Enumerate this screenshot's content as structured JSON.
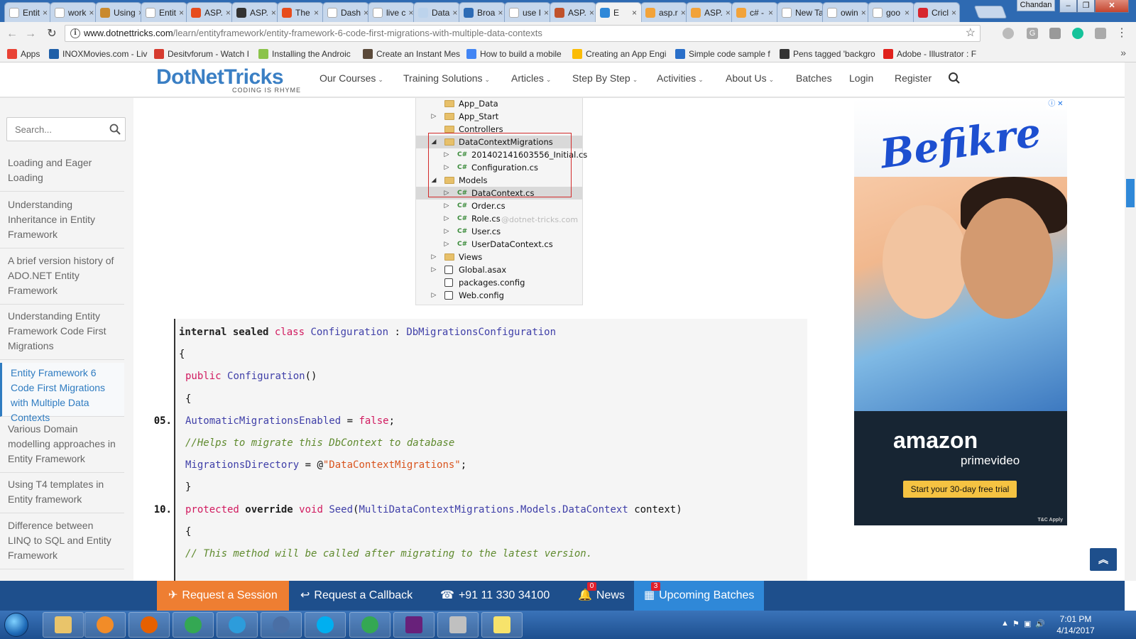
{
  "browser": {
    "tabs": [
      {
        "label": "Entit",
        "color": "#ffffff"
      },
      {
        "label": "work",
        "color": "#ffffff"
      },
      {
        "label": "Using",
        "color": "#c98a2e"
      },
      {
        "label": "Entit",
        "color": "#ffffff"
      },
      {
        "label": "ASP.",
        "color": "#e74c1c"
      },
      {
        "label": "ASP.",
        "color": "#333333"
      },
      {
        "label": "The",
        "color": "#e74c1c"
      },
      {
        "label": "Dash",
        "color": "#ffffff"
      },
      {
        "label": "live c",
        "color": "#ffffff"
      },
      {
        "label": "Data",
        "color": "#bcd3ec"
      },
      {
        "label": "Broa",
        "color": "#2d6bb5"
      },
      {
        "label": "use I",
        "color": "#ffffff"
      },
      {
        "label": "ASP.",
        "color": "#c0522b"
      },
      {
        "label": "E",
        "color": "#2f88d8"
      },
      {
        "label": "asp.r",
        "color": "#f2a33a"
      },
      {
        "label": "ASP.",
        "color": "#f2a33a"
      },
      {
        "label": "c# -",
        "color": "#f2a33a"
      },
      {
        "label": "New Tab",
        "color": "#ffffff"
      },
      {
        "label": "owin",
        "color": "#ffffff"
      },
      {
        "label": "goo",
        "color": "#ffffff"
      },
      {
        "label": "Cricl",
        "color": "#d7262e"
      }
    ],
    "active_tab_index": 13,
    "tab_close_glyph": "×",
    "profile_name": "Chandan",
    "window_controls": [
      "–",
      "❐",
      "✕"
    ],
    "url_host": "www.dotnettricks.com",
    "url_path": "/learn/entityframework/entity-framework-6-code-first-migrations-with-multiple-data-contexts",
    "nav_glyphs": {
      "back": "←",
      "forward": "→",
      "reload": "↻",
      "star": "☆",
      "info": "i",
      "more": "»"
    },
    "bookmarks": [
      {
        "label": "Apps",
        "color": "#e94235"
      },
      {
        "label": "INOXMovies.com - Liv",
        "color": "#1f5fa8"
      },
      {
        "label": "Desitvforum - Watch I",
        "color": "#d63b2f"
      },
      {
        "label": "Installing the Androic",
        "color": "#8bc34a"
      },
      {
        "label": "Create an Instant Mes",
        "color": "#5b4a3a"
      },
      {
        "label": "How to build a mobile",
        "color": "#4285f4"
      },
      {
        "label": "Creating an App Engi",
        "color": "#fbbc05"
      },
      {
        "label": "Simple code sample f",
        "color": "#2a6fc9"
      },
      {
        "label": "Pens tagged 'backgro",
        "color": "#333333"
      },
      {
        "label": "Adobe - Illustrator : F",
        "color": "#e0201b"
      }
    ]
  },
  "site": {
    "logo_main": "DotNetTricks",
    "logo_tag": "CODING IS RHYME",
    "nav": [
      {
        "label": "Our Courses",
        "chevron": "⌄"
      },
      {
        "label": "Training Solutions",
        "chevron": "⌄"
      },
      {
        "label": "Articles",
        "chevron": "⌄"
      },
      {
        "label": "Step By Step",
        "chevron": "⌄"
      },
      {
        "label": "Activities",
        "chevron": "⌄"
      },
      {
        "label": "About Us",
        "chevron": "⌄"
      },
      {
        "label": "Batches",
        "chevron": ""
      },
      {
        "label": "Login",
        "chevron": ""
      },
      {
        "label": "Register",
        "chevron": ""
      }
    ]
  },
  "sidebar": {
    "search_placeholder": "Search...",
    "items": [
      {
        "label": "Loading and Eager Loading",
        "active": false
      },
      {
        "label": "Understanding Inheritance in Entity Framework",
        "active": false
      },
      {
        "label": "A brief version history of ADO.NET Entity Framework",
        "active": false
      },
      {
        "label": "Understanding Entity Framework Code First Migrations",
        "active": false
      },
      {
        "label": "Entity Framework 6 Code First Migrations with Multiple Data Contexts",
        "active": true
      },
      {
        "label": "Various Domain modelling approaches in Entity Framework",
        "active": false
      },
      {
        "label": "Using T4 templates in Entity framework",
        "active": false
      },
      {
        "label": "Difference between LINQ to SQL and Entity Framework",
        "active": false
      }
    ]
  },
  "solution_tree": {
    "watermark": "@dotnet-tricks.com",
    "rows": [
      {
        "label": "App_Data",
        "kind": "folder",
        "indent": 1,
        "arrow": "",
        "selected": false
      },
      {
        "label": "App_Start",
        "kind": "folder",
        "indent": 1,
        "arrow": "▷",
        "selected": false
      },
      {
        "label": "Controllers",
        "kind": "folder",
        "indent": 1,
        "arrow": "",
        "selected": false
      },
      {
        "label": "DataContextMigrations",
        "kind": "folder",
        "indent": 1,
        "arrow": "◢",
        "selected": true
      },
      {
        "label": "201402141603556_Initial.cs",
        "kind": "cs",
        "indent": 2,
        "arrow": "▷",
        "selected": false
      },
      {
        "label": "Configuration.cs",
        "kind": "cs",
        "indent": 2,
        "arrow": "▷",
        "selected": false
      },
      {
        "label": "Models",
        "kind": "folder",
        "indent": 1,
        "arrow": "◢",
        "selected": false
      },
      {
        "label": "DataContext.cs",
        "kind": "cs",
        "indent": 2,
        "arrow": "▷",
        "selected": true
      },
      {
        "label": "Order.cs",
        "kind": "cs",
        "indent": 2,
        "arrow": "▷",
        "selected": false
      },
      {
        "label": "Role.cs",
        "kind": "cs",
        "indent": 2,
        "arrow": "▷",
        "selected": false
      },
      {
        "label": "User.cs",
        "kind": "cs",
        "indent": 2,
        "arrow": "▷",
        "selected": false
      },
      {
        "label": "UserDataContext.cs",
        "kind": "cs",
        "indent": 2,
        "arrow": "▷",
        "selected": false
      },
      {
        "label": "Views",
        "kind": "folder",
        "indent": 1,
        "arrow": "▷",
        "selected": false
      },
      {
        "label": "Global.asax",
        "kind": "config",
        "indent": 1,
        "arrow": "▷",
        "selected": false
      },
      {
        "label": "packages.config",
        "kind": "config",
        "indent": 1,
        "arrow": "",
        "selected": false
      },
      {
        "label": "Web.config",
        "kind": "config",
        "indent": 1,
        "arrow": "▷",
        "selected": false
      }
    ],
    "cs_badge": "C#"
  },
  "code": {
    "lines": [
      {
        "no": "",
        "indent": 0,
        "tokens": [
          {
            "t": "internal sealed ",
            "c": "kwb"
          },
          {
            "t": "class ",
            "c": "kw"
          },
          {
            "t": "Configuration",
            "c": "ty"
          },
          {
            "t": " : ",
            "c": "pl"
          },
          {
            "t": "DbMigrationsConfiguration",
            "c": "ty"
          }
        ]
      },
      {
        "no": "",
        "indent": 0,
        "tokens": [
          {
            "t": "{",
            "c": "pl"
          }
        ]
      },
      {
        "no": "",
        "indent": 1,
        "tokens": [
          {
            "t": "public ",
            "c": "kw"
          },
          {
            "t": "Configuration",
            "c": "ty"
          },
          {
            "t": "()",
            "c": "pl"
          }
        ]
      },
      {
        "no": "",
        "indent": 1,
        "tokens": [
          {
            "t": "{",
            "c": "pl"
          }
        ]
      },
      {
        "no": "05.",
        "indent": 1,
        "tokens": [
          {
            "t": "AutomaticMigrationsEnabled",
            "c": "ty"
          },
          {
            "t": " = ",
            "c": "pl"
          },
          {
            "t": "false",
            "c": "kw"
          },
          {
            "t": ";",
            "c": "pl"
          }
        ]
      },
      {
        "no": "",
        "indent": 1,
        "tokens": [
          {
            "t": "//Helps to migrate this DbContext to database",
            "c": "cm"
          }
        ]
      },
      {
        "no": "",
        "indent": 1,
        "tokens": [
          {
            "t": "MigrationsDirectory",
            "c": "ty"
          },
          {
            "t": " = @",
            "c": "pl"
          },
          {
            "t": "\"DataContextMigrations\"",
            "c": "st"
          },
          {
            "t": ";",
            "c": "pl"
          }
        ]
      },
      {
        "no": "",
        "indent": 1,
        "tokens": [
          {
            "t": "}",
            "c": "pl"
          }
        ]
      },
      {
        "no": "10.",
        "indent": 1,
        "tokens": [
          {
            "t": "protected ",
            "c": "kw"
          },
          {
            "t": "override ",
            "c": "kwb"
          },
          {
            "t": "void ",
            "c": "kw"
          },
          {
            "t": "Seed",
            "c": "ty"
          },
          {
            "t": "(",
            "c": "pl"
          },
          {
            "t": "MultiDataContextMigrations.Models.DataContext",
            "c": "ty"
          },
          {
            "t": " context)",
            "c": "pl"
          }
        ]
      },
      {
        "no": "",
        "indent": 1,
        "tokens": [
          {
            "t": "{",
            "c": "pl"
          }
        ]
      },
      {
        "no": "",
        "indent": 1,
        "tokens": [
          {
            "t": "// This method will be called after migrating to the latest version.",
            "c": "cm"
          }
        ]
      }
    ]
  },
  "ad": {
    "title": "Befikre",
    "brand": "amazon",
    "brand_sub": "primevideo",
    "cta": "Start your 30-day free trial",
    "tc": "T&C Apply",
    "adchoices": "ⓘ ✕"
  },
  "back_to_top_glyph": "︽",
  "actionbar": {
    "items": [
      {
        "label": "Request a Session",
        "glyph": "✈",
        "badge": ""
      },
      {
        "label": "Request a Callback",
        "glyph": "↩",
        "badge": ""
      },
      {
        "label": "+91 11 330 34100",
        "glyph": "☎",
        "badge": ""
      },
      {
        "label": "News",
        "glyph": "🔔",
        "badge": "0"
      },
      {
        "label": "Upcoming Batches",
        "glyph": "▦",
        "badge": "3"
      }
    ]
  },
  "taskbar": {
    "apps": [
      {
        "name": "explorer",
        "color": "#e9c46a"
      },
      {
        "name": "media-player",
        "color": "#f28c28"
      },
      {
        "name": "firefox",
        "color": "#e66000"
      },
      {
        "name": "chrome",
        "color": "#34a853"
      },
      {
        "name": "internet-explorer",
        "color": "#2d9cdb"
      },
      {
        "name": "network-tool",
        "color": "#4a6fa5"
      },
      {
        "name": "skype",
        "color": "#00aff0"
      },
      {
        "name": "chrome-2",
        "color": "#34a853"
      },
      {
        "name": "visual-studio",
        "color": "#68217a"
      },
      {
        "name": "snipping-tool",
        "color": "#c0c0c0"
      },
      {
        "name": "sticky-notes",
        "color": "#f7e36b"
      }
    ],
    "time": "7:01 PM",
    "date": "4/14/2017",
    "tray_glyphs": [
      "▲",
      "⚑",
      "▣",
      "🔊"
    ]
  }
}
